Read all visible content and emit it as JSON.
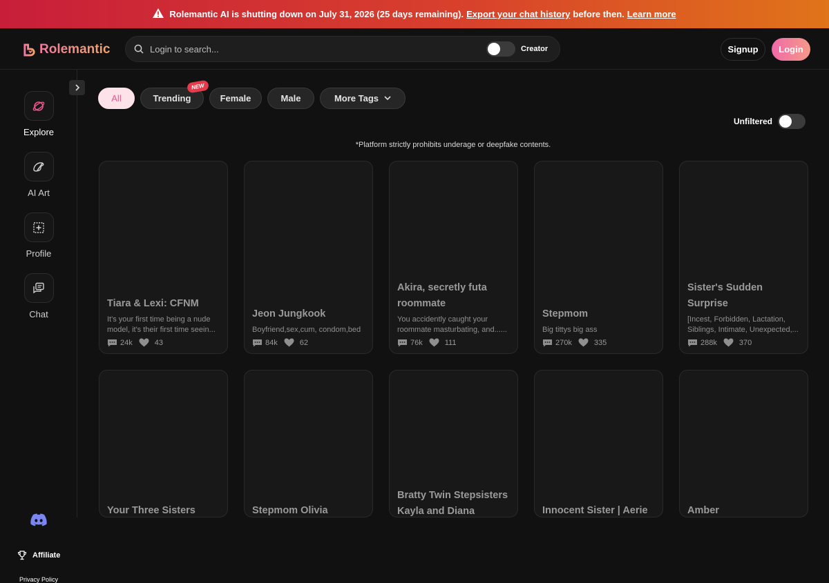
{
  "banner": {
    "icon": "warning-icon",
    "text": "Rolemantic AI is shutting down on July 31, 2026 (25 days remaining).",
    "export_link": "Export your chat history",
    "middle": "before then.",
    "learn_more": "Learn more"
  },
  "header": {
    "app_name": "Rolemantic",
    "search_placeholder": "Login to search...",
    "creator_label": "Creator",
    "signup_label": "Signup",
    "login_label": "Login"
  },
  "sidebar": {
    "items": [
      {
        "label": "Explore",
        "icon": "explore-icon"
      },
      {
        "label": "AI Art",
        "icon": "ai-art-icon"
      },
      {
        "label": "Profile",
        "icon": "profile-icon"
      },
      {
        "label": "Chat",
        "icon": "chat-icon"
      }
    ],
    "affiliate_label": "Affiliate",
    "privacy_label": "Privacy Policy"
  },
  "tags": {
    "all": "All",
    "trending": "Trending",
    "new_badge": "NEW",
    "female": "Female",
    "male": "Male",
    "more": "More Tags"
  },
  "filter": {
    "unfiltered_label": "Unfiltered"
  },
  "notice": "*Platform strictly prohibits underage or deepfake contents.",
  "cards": [
    {
      "title": "Tiara & Lexi: CFNM",
      "desc": "It's your first time being a nude model, it's their first time seein...",
      "chats": "24k",
      "likes": "43"
    },
    {
      "title": "Jeon Jungkook",
      "desc": "Boyfriend,sex,cum, condom,bed",
      "chats": "84k",
      "likes": "62"
    },
    {
      "title": "Akira, secretly futa roommate",
      "desc": "You accidently caught your roommate masturbating, and......",
      "chats": "76k",
      "likes": "111"
    },
    {
      "title": "Stepmom",
      "desc": "Big tittys big ass",
      "chats": "270k",
      "likes": "335"
    },
    {
      "title": "Sister's Sudden Surprise",
      "desc": "[Incest, Forbidden, Lactation, Siblings, Intimate, Unexpected,...",
      "chats": "288k",
      "likes": "370"
    },
    {
      "title": "Your Three Sisters"
    },
    {
      "title": "Stepmom Olivia"
    },
    {
      "title": "Bratty Twin Stepsisters Kayla and Diana"
    },
    {
      "title": "Innocent Sister | Aerie"
    },
    {
      "title": "Amber"
    }
  ],
  "colors": {
    "accent_pink": "#e8578d",
    "banner_start": "#c81e3a",
    "banner_end": "#e0741a",
    "background": "#111111"
  }
}
